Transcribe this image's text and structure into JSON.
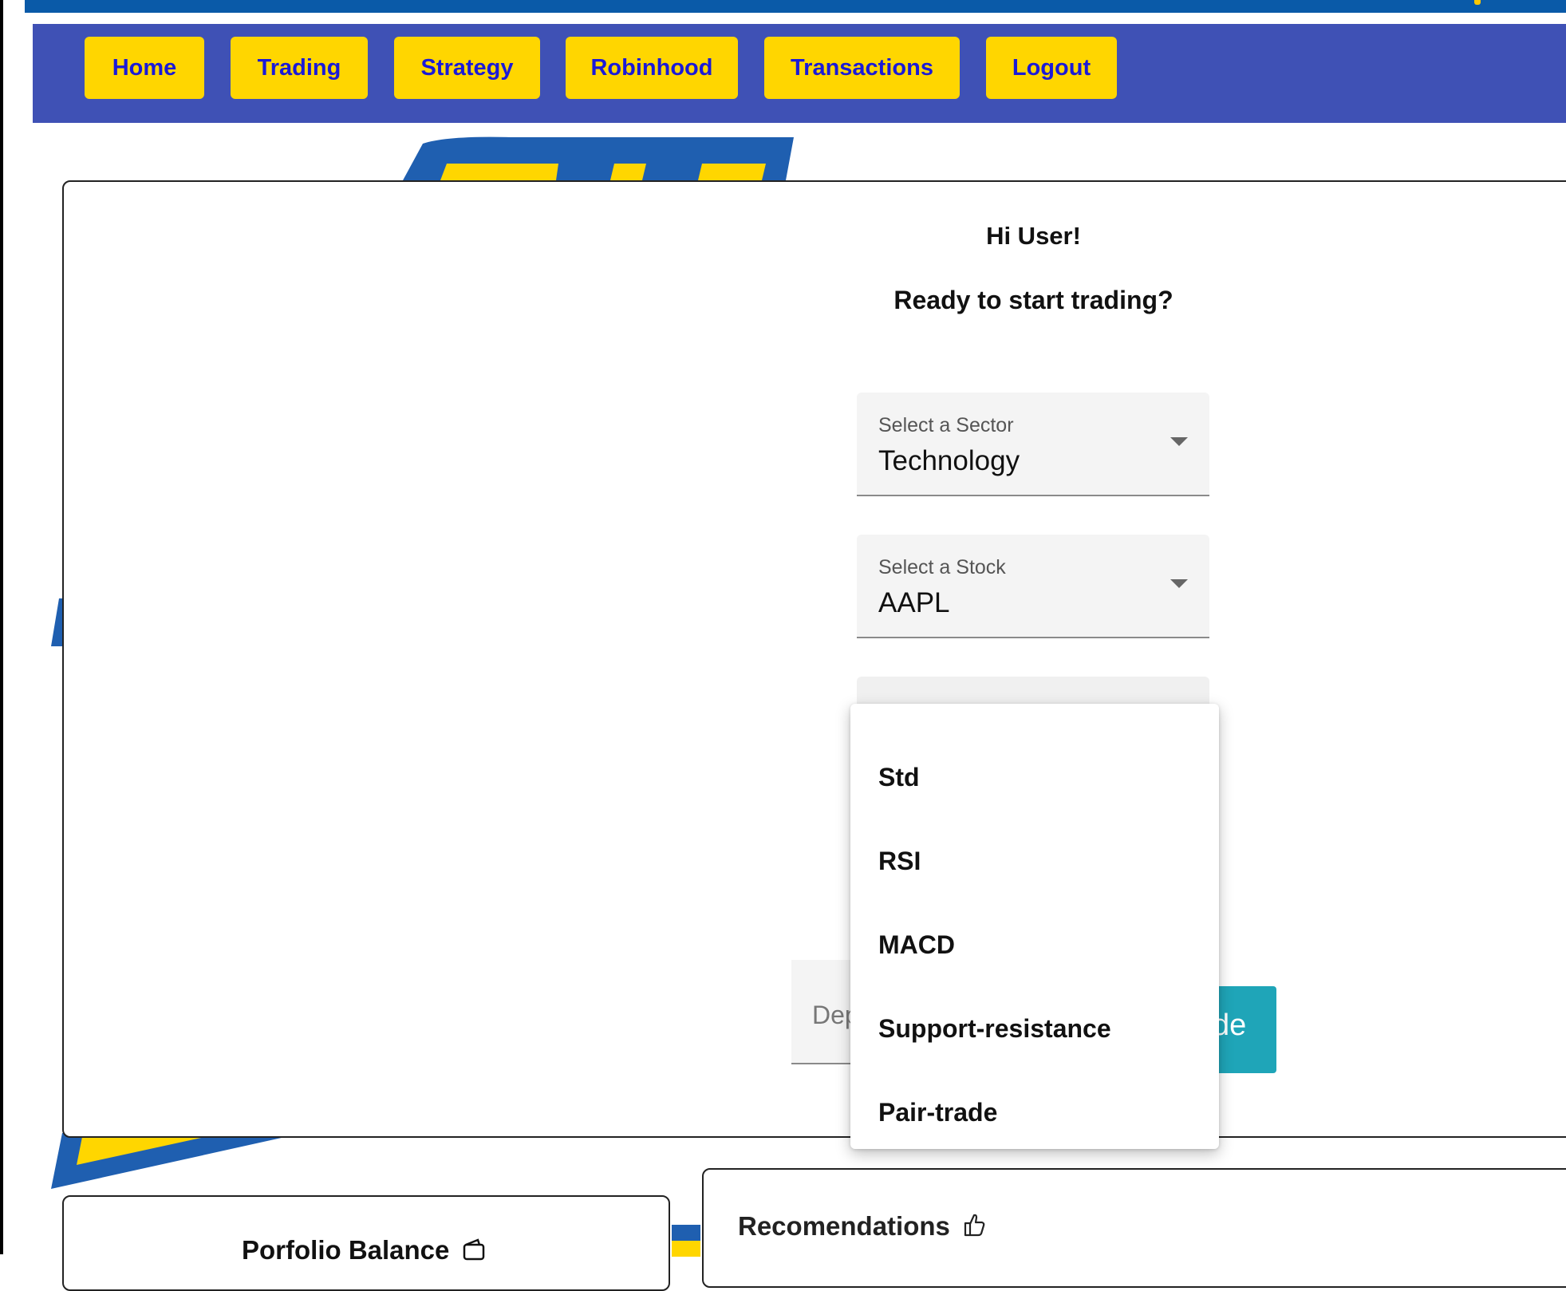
{
  "nav": {
    "items": [
      {
        "label": "Home"
      },
      {
        "label": "Trading"
      },
      {
        "label": "Strategy"
      },
      {
        "label": "Robinhood"
      },
      {
        "label": "Transactions"
      },
      {
        "label": "Logout"
      }
    ]
  },
  "main": {
    "greeting": "Hi User!",
    "subgreeting": "Ready to start trading?",
    "sector_select": {
      "label": "Select a Sector",
      "value": "Technology"
    },
    "stock_select": {
      "label": "Select a Stock",
      "value": "AAPL"
    },
    "strategy_menu": {
      "options": [
        "Std",
        "RSI",
        "MACD",
        "Support-resistance",
        "Pair-trade"
      ]
    },
    "deposit_placeholder_visible": "Dep",
    "trade_button_visible": "de"
  },
  "portfolio": {
    "title": "Porfolio Balance"
  },
  "recommendations": {
    "title": "Recomendations"
  },
  "colors": {
    "navbar": "#3f51b5",
    "nav_button": "#ffd600",
    "nav_text": "#1a1ad8",
    "trade_button": "#1fa5b8",
    "logo_blue": "#1f5fb0",
    "logo_yellow": "#ffd600"
  },
  "icons": {
    "portfolio": "wallet-icon",
    "recommendations": "thumbs-up-icon",
    "select_arrow": "caret-down-icon"
  }
}
